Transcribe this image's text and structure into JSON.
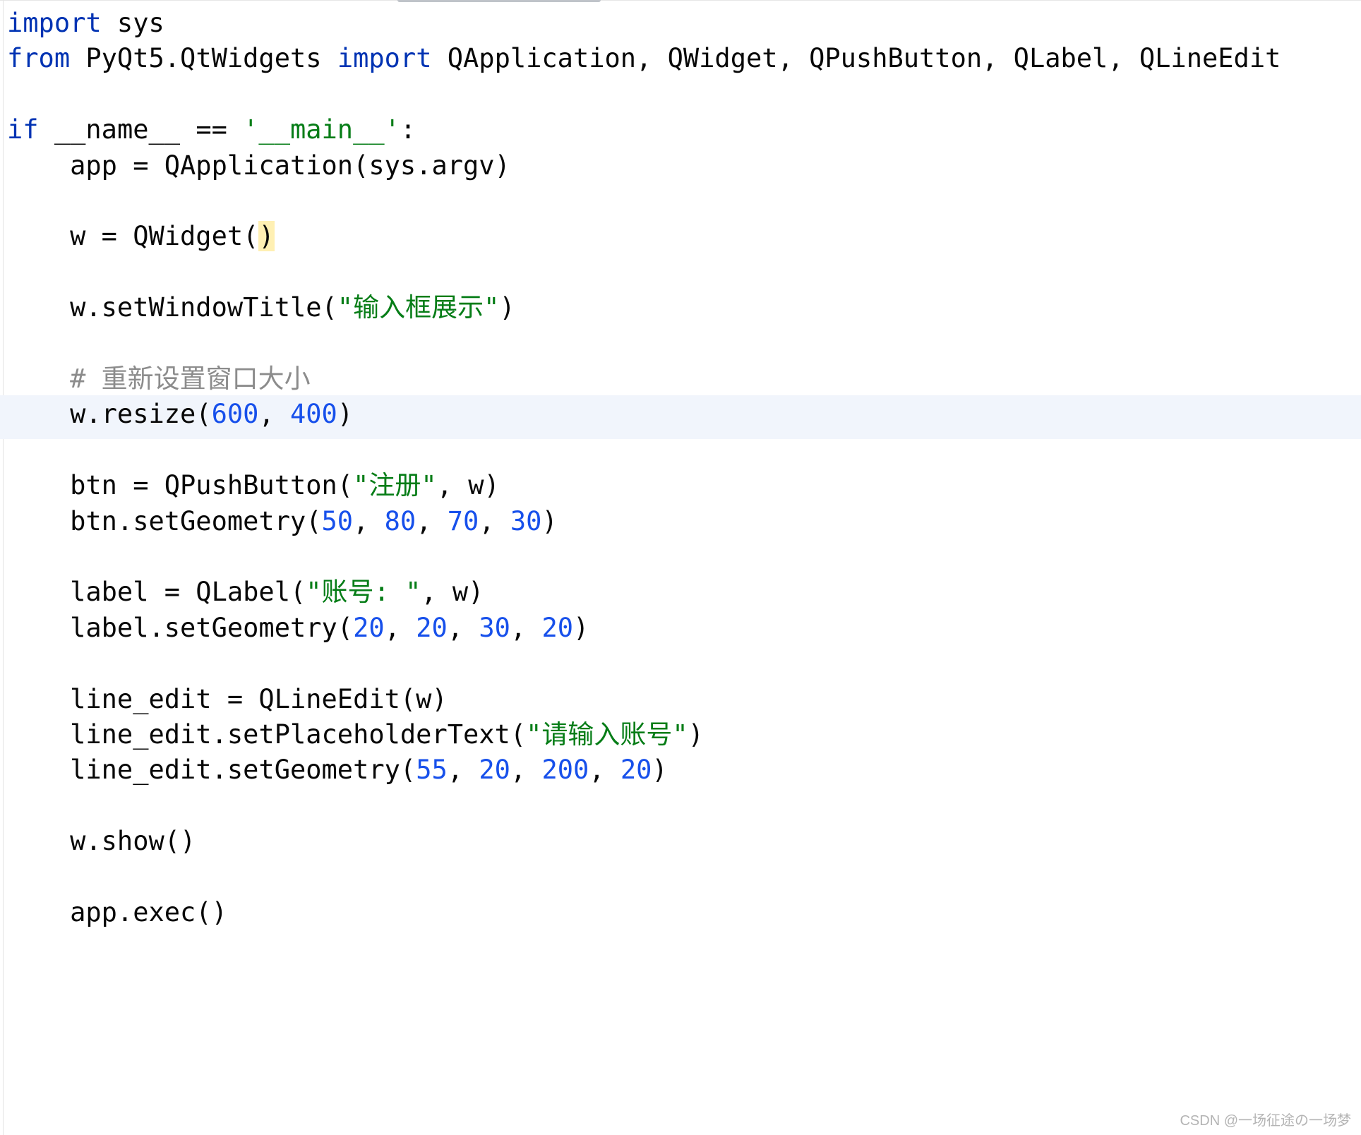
{
  "colors": {
    "keyword": "#0033b3",
    "string": "#067d17",
    "number": "#1750eb",
    "comment": "#8c8c8c",
    "default": "#080808",
    "caret_line": "#f1f5fc",
    "bracket_highlight": "#fff0b3"
  },
  "code_lines": [
    {
      "tokens": [
        {
          "t": "import",
          "c": "kw"
        },
        {
          "t": " sys",
          "c": "plain"
        }
      ]
    },
    {
      "tokens": [
        {
          "t": "from",
          "c": "kw"
        },
        {
          "t": " PyQt5.QtWidgets ",
          "c": "plain"
        },
        {
          "t": "import",
          "c": "kw"
        },
        {
          "t": " QApplication, QWidget, QPushButton, QLabel, QLineEdit",
          "c": "plain"
        }
      ]
    },
    {
      "tokens": []
    },
    {
      "tokens": [
        {
          "t": "if",
          "c": "kw"
        },
        {
          "t": " __name__ == ",
          "c": "plain"
        },
        {
          "t": "'__main__'",
          "c": "str"
        },
        {
          "t": ":",
          "c": "plain"
        }
      ]
    },
    {
      "tokens": [
        {
          "t": "    app = QApplication(sys.argv)",
          "c": "plain"
        }
      ]
    },
    {
      "tokens": []
    },
    {
      "tokens": [
        {
          "t": "    w = QWidget(",
          "c": "plain"
        },
        {
          "t": ")",
          "c": "plain",
          "hl": true
        }
      ]
    },
    {
      "tokens": []
    },
    {
      "tokens": [
        {
          "t": "    w.setWindowTitle(",
          "c": "plain"
        },
        {
          "t": "\"输入框展示\"",
          "c": "str"
        },
        {
          "t": ")",
          "c": "plain"
        }
      ]
    },
    {
      "tokens": [],
      "caret": true
    },
    {
      "tokens": [
        {
          "t": "    # 重新设置窗口大小",
          "c": "cmt"
        }
      ]
    },
    {
      "tokens": [
        {
          "t": "    w.resize(",
          "c": "plain"
        },
        {
          "t": "600",
          "c": "num"
        },
        {
          "t": ", ",
          "c": "plain"
        },
        {
          "t": "400",
          "c": "num"
        },
        {
          "t": ")",
          "c": "plain"
        }
      ]
    },
    {
      "tokens": []
    },
    {
      "tokens": [
        {
          "t": "    btn = QPushButton(",
          "c": "plain"
        },
        {
          "t": "\"注册\"",
          "c": "str"
        },
        {
          "t": ", w)",
          "c": "plain"
        }
      ]
    },
    {
      "tokens": [
        {
          "t": "    btn.setGeometry(",
          "c": "plain"
        },
        {
          "t": "50",
          "c": "num"
        },
        {
          "t": ", ",
          "c": "plain"
        },
        {
          "t": "80",
          "c": "num"
        },
        {
          "t": ", ",
          "c": "plain"
        },
        {
          "t": "70",
          "c": "num"
        },
        {
          "t": ", ",
          "c": "plain"
        },
        {
          "t": "30",
          "c": "num"
        },
        {
          "t": ")",
          "c": "plain"
        }
      ]
    },
    {
      "tokens": []
    },
    {
      "tokens": [
        {
          "t": "    label = QLabel(",
          "c": "plain"
        },
        {
          "t": "\"账号: \"",
          "c": "str"
        },
        {
          "t": ", w)",
          "c": "plain"
        }
      ]
    },
    {
      "tokens": [
        {
          "t": "    label.setGeometry(",
          "c": "plain"
        },
        {
          "t": "20",
          "c": "num"
        },
        {
          "t": ", ",
          "c": "plain"
        },
        {
          "t": "20",
          "c": "num"
        },
        {
          "t": ", ",
          "c": "plain"
        },
        {
          "t": "30",
          "c": "num"
        },
        {
          "t": ", ",
          "c": "plain"
        },
        {
          "t": "20",
          "c": "num"
        },
        {
          "t": ")",
          "c": "plain"
        }
      ]
    },
    {
      "tokens": []
    },
    {
      "tokens": [
        {
          "t": "    line_edit = QLineEdit(w)",
          "c": "plain"
        }
      ]
    },
    {
      "tokens": [
        {
          "t": "    line_edit.setPlaceholderText(",
          "c": "plain"
        },
        {
          "t": "\"请输入账号\"",
          "c": "str"
        },
        {
          "t": ")",
          "c": "plain"
        }
      ]
    },
    {
      "tokens": [
        {
          "t": "    line_edit.setGeometry(",
          "c": "plain"
        },
        {
          "t": "55",
          "c": "num"
        },
        {
          "t": ", ",
          "c": "plain"
        },
        {
          "t": "20",
          "c": "num"
        },
        {
          "t": ", ",
          "c": "plain"
        },
        {
          "t": "200",
          "c": "num"
        },
        {
          "t": ", ",
          "c": "plain"
        },
        {
          "t": "20",
          "c": "num"
        },
        {
          "t": ")",
          "c": "plain"
        }
      ]
    },
    {
      "tokens": []
    },
    {
      "tokens": [
        {
          "t": "    w.show()",
          "c": "plain"
        }
      ]
    },
    {
      "tokens": []
    },
    {
      "tokens": [
        {
          "t": "    app.exec()",
          "c": "plain"
        }
      ]
    }
  ],
  "watermark": "CSDN @一场征途の一场梦"
}
